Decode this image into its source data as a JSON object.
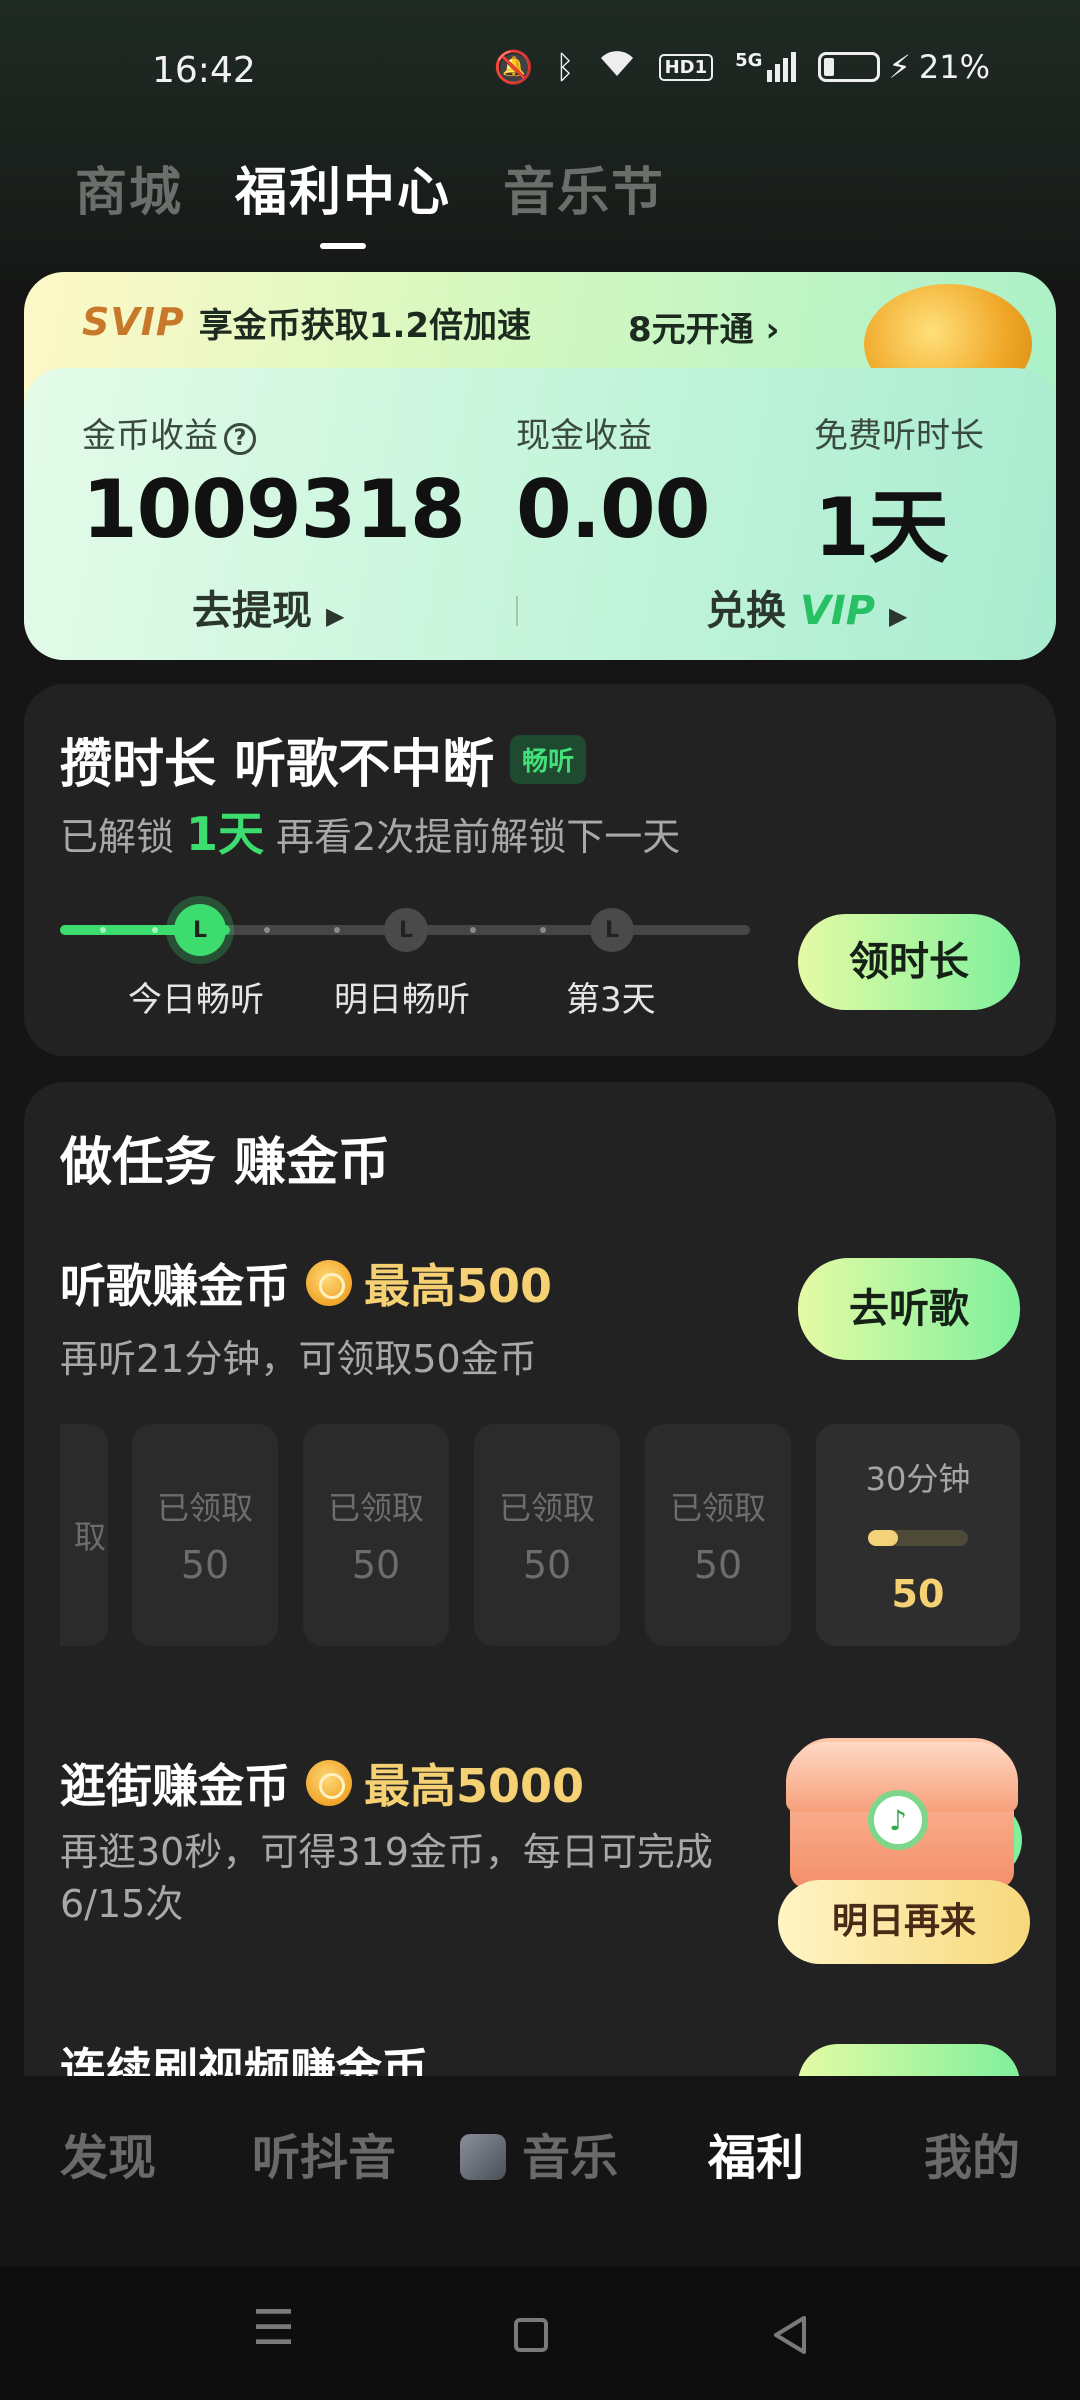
{
  "status": {
    "time": "16:42",
    "battery": "21%",
    "hd": "HD1",
    "network": "5G"
  },
  "top_tabs": [
    "商城",
    "福利中心",
    "音乐节"
  ],
  "svip": {
    "logo": "SVIP",
    "promo": "享金币获取1.2倍加速",
    "cta": "8元开通 ›"
  },
  "stats": {
    "coin_label": "金币收益",
    "coin_value": "1009318",
    "cash_label": "现金收益",
    "cash_value": "0.00",
    "free_label": "免费听时长",
    "free_value": "1天",
    "withdraw": "去提现",
    "exchange": "兑换",
    "vip": "VIP"
  },
  "listen": {
    "title": "攒时长 听歌不中断",
    "tag": "畅听",
    "sub_prefix": "已解锁",
    "sub_days": "1天",
    "sub_suffix": "再看2次提前解锁下一天",
    "nodes": [
      "今日畅听",
      "明日畅听",
      "第3天"
    ],
    "button": "领时长"
  },
  "tasks": {
    "title": "做任务 赚金币",
    "music": {
      "title": "听歌赚金币",
      "max": "最高500",
      "desc": "再听21分钟，可领取50金币",
      "button": "去听歌",
      "slots": [
        {
          "status": "取",
          "coins": ""
        },
        {
          "status": "已领取",
          "coins": "50"
        },
        {
          "status": "已领取",
          "coins": "50"
        },
        {
          "status": "已领取",
          "coins": "50"
        },
        {
          "status": "已领取",
          "coins": "50"
        }
      ],
      "current_slot": {
        "time": "30分钟",
        "coins": "50",
        "progress": 0.3
      }
    },
    "shop": {
      "title": "逛街赚金币",
      "max": "最高5000",
      "desc_line1": "再逛30秒，可得319金币，每日可完成",
      "desc_line2": "6/15次",
      "button": "明日再来"
    },
    "video": {
      "title": "连续刷视频赚金币"
    }
  },
  "bottom_nav": [
    "发现",
    "听抖音",
    "音乐",
    "福利",
    "我的"
  ],
  "colors": {
    "accent_green": "#3ddc6e",
    "gold": "#f5d174",
    "background": "#151515"
  }
}
